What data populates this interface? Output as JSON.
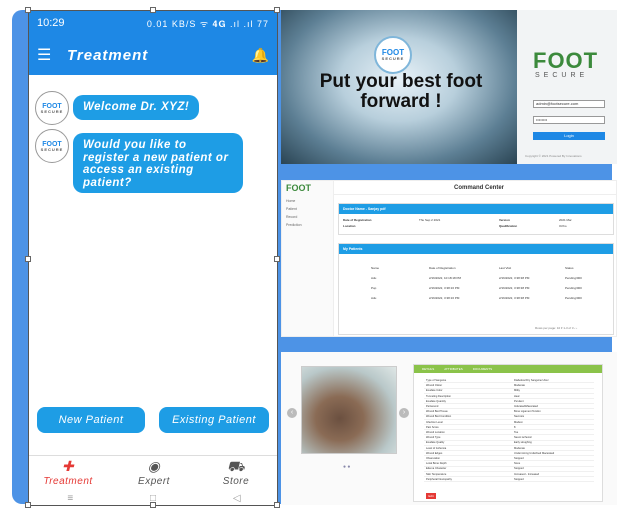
{
  "phone": {
    "status_time": "10:29",
    "status_right": "0.01 KB/S ᯤ 𝟒𝐆 .ıl .ıl 77",
    "app_title": "Treatment",
    "logo_text": "FOOT",
    "logo_sub": "SECURE",
    "messages": [
      "Welcome Dr. XYZ!",
      "Would you like to register a new patient or access an existing patient?"
    ],
    "buttons": {
      "new": "New Patient",
      "existing": "Existing Patient"
    },
    "nav": [
      {
        "label": "Treatment",
        "icon": "bandage-icon"
      },
      {
        "label": "Expert",
        "icon": "person-icon"
      },
      {
        "label": "Store",
        "icon": "cart-icon"
      }
    ],
    "sys_nav": [
      "≡",
      "□",
      "◁"
    ]
  },
  "login": {
    "logo_text": "FOOT",
    "logo_sub": "SECURE",
    "headline": "Put your best foot forward !",
    "brand": "FOOT",
    "brand_sub": "SECURE",
    "email_value": "admin@footsecure.com",
    "password_value": "••••••••",
    "login_label": "Login",
    "footer": "Copyright © 2021 Powered By Innovations"
  },
  "command": {
    "logo": "FOOT",
    "title": "Command Center",
    "side_items": [
      "Home",
      "Patient",
      "Record",
      "Prediction"
    ],
    "doctor_header": "Doctor Name - Sanjay pdf",
    "doctor_fields": [
      {
        "k": "Date of Registration",
        "v": "Thu Sep 2 2021",
        "k2": "Version",
        "v2": "2021 Mar"
      },
      {
        "k": "Location",
        "v": "",
        "k2": "Qualification",
        "v2": "Ortho"
      }
    ],
    "patients_header": "My Patients",
    "patient_cols": [
      "Name",
      "Date of Registration",
      "Last Visit",
      "Status"
    ],
    "patients": [
      {
        "name": "Adu",
        "reg": "2/16/2022, 10:18:18 PM",
        "last": "2/16/2022, 3:38:38 PM",
        "status": "Pending/000"
      },
      {
        "name": "Pop",
        "reg": "2/16/2022, 3:38:16 PM",
        "last": "2/16/2022, 3:38:38 PM",
        "status": "Pending/000"
      },
      {
        "name": "Adu",
        "reg": "2/16/2022, 3:38:16 PM",
        "last": "2/16/2022, 3:38:38 PM",
        "status": "Pending/000"
      }
    ],
    "pager": "Rows per page: 10 ▾   1-3 of 3   ‹   ›"
  },
  "details": {
    "tabs": [
      "DETAILS",
      "ATTRIBUTES",
      "DOCUMENTS"
    ],
    "rows": [
      [
        "Type of Sanguine",
        "Diabetical Dry Sanguine Ulcer"
      ],
      [
        "Wound Odour",
        "Moderate"
      ],
      [
        "Exudate Color",
        "Milky"
      ],
      [
        "Tunneling Description",
        "Heal"
      ],
      [
        "Exudate Quantity",
        "Purulent"
      ],
      [
        "Periwound",
        "Indurated/Macerated"
      ],
      [
        "Wound Bed Tissue",
        "Bone Ligament Tendon"
      ],
      [
        "Wound Bed Condition",
        "Necrosis"
      ],
      [
        "Infection Level",
        "Modest"
      ],
      [
        "Pain Score",
        "8"
      ],
      [
        "Wound Location",
        "Toe"
      ],
      [
        "Wound Type",
        "Neuro ischemic"
      ],
      [
        "Exudate Quality",
        "Early sloughing"
      ],
      [
        "Level of Ischemia",
        "Moderate"
      ],
      [
        "Wound Edges",
        "Undermining Undefined Macerated"
      ],
      [
        "Observation",
        "Stopped"
      ],
      [
        "Local Bone Depth",
        "None"
      ],
      [
        "Edema Character",
        "Stopped"
      ],
      [
        "Skin Temperature",
        "Increased - Increased"
      ],
      [
        "Peripheral Neuropathy",
        "Stopped"
      ]
    ],
    "edit_label": "Edit"
  }
}
